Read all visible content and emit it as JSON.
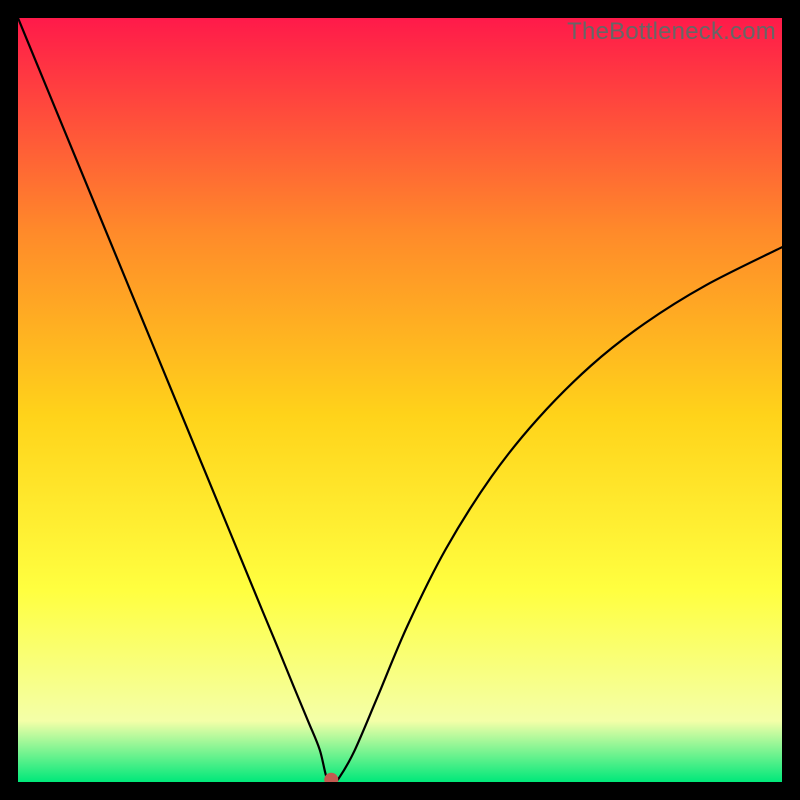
{
  "watermark": "TheBottleneck.com",
  "chart_data": {
    "type": "line",
    "title": "",
    "xlabel": "",
    "ylabel": "",
    "xlim": [
      0,
      100
    ],
    "ylim": [
      0,
      100
    ],
    "grid": false,
    "background_gradient": {
      "top": "#ff1a4a",
      "mid_upper": "#ff8a2a",
      "mid": "#ffd31a",
      "mid_lower": "#ffff40",
      "near_bottom": "#f4ffa8",
      "bottom": "#00e87a"
    },
    "series": [
      {
        "name": "bottleneck-curve",
        "color": "#000000",
        "x": [
          0,
          4,
          8,
          12,
          16,
          20,
          24,
          28,
          32,
          34,
          36,
          38,
          39.5,
          40.5,
          41.5,
          42,
          44,
          47,
          51,
          56,
          62,
          68,
          75,
          82,
          90,
          100
        ],
        "y": [
          100,
          90.3,
          80.6,
          70.9,
          61.2,
          51.5,
          41.8,
          32.1,
          22.4,
          17.6,
          12.7,
          7.9,
          4.2,
          0.3,
          0.3,
          0.5,
          4.0,
          11.0,
          20.5,
          30.5,
          40.0,
          47.5,
          54.5,
          60.0,
          65.0,
          70.0
        ]
      }
    ],
    "marker": {
      "name": "optimum-point",
      "x": 41,
      "y": 0.3,
      "color": "#c35a50",
      "radius_px": 7
    }
  }
}
